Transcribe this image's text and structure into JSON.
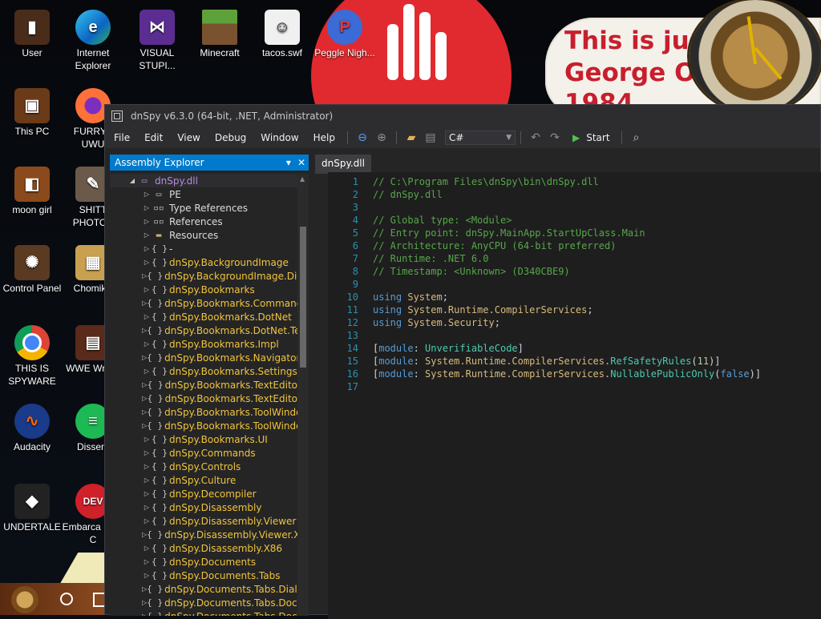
{
  "desktop": {
    "icons": [
      {
        "label": "User",
        "icon": "user-folder-icon"
      },
      {
        "label": "Internet Explorer",
        "icon": "edge-icon"
      },
      {
        "label": "VISUAL STUPI...",
        "icon": "visual-studio-icon"
      },
      {
        "label": "Minecraft",
        "icon": "minecraft-icon"
      },
      {
        "label": "tacos.swf",
        "icon": "swf-file-icon"
      },
      {
        "label": "Peggle Nigh...",
        "icon": "peggle-icon"
      },
      {
        "label": "This PC",
        "icon": "this-pc-icon"
      },
      {
        "label": "FURRYF UWU",
        "icon": "firefox-icon"
      },
      {
        "label": "moon girl",
        "icon": "moon-girl-icon"
      },
      {
        "label": "SHITT PHOTOS",
        "icon": "gimp-icon"
      },
      {
        "label": "Control Panel",
        "icon": "control-panel-icon"
      },
      {
        "label": "ChomikB",
        "icon": "chomik-icon"
      },
      {
        "label": "THIS IS SPYWARE",
        "icon": "chrome-icon"
      },
      {
        "label": "WWE Wrestl",
        "icon": "wwe-icon"
      },
      {
        "label": "Audacity",
        "icon": "audacity-icon"
      },
      {
        "label": "Dissent",
        "icon": "dissent-icon"
      },
      {
        "label": "UNDERTALE",
        "icon": "unity-icon"
      },
      {
        "label": "Embarca Dev-C",
        "icon": "devcpp-icon"
      }
    ],
    "wallpaper_text": [
      "This is just",
      "George Or",
      "1984"
    ]
  },
  "window": {
    "title": "dnSpy v6.3.0 (64-bit, .NET, Administrator)",
    "menu": [
      "File",
      "Edit",
      "View",
      "Debug",
      "Window",
      "Help"
    ],
    "language": "C#",
    "start_label": "Start"
  },
  "explorer": {
    "title": "Assembly Explorer",
    "root": "dnSpy.dll",
    "items": [
      {
        "label": "PE",
        "type": "pe"
      },
      {
        "label": "Type References",
        "type": "ref"
      },
      {
        "label": "References",
        "type": "ref"
      },
      {
        "label": "Resources",
        "type": "folder"
      },
      {
        "label": "-",
        "type": "ns"
      },
      {
        "label": "dnSpy.BackgroundImage",
        "type": "ns"
      },
      {
        "label": "dnSpy.BackgroundImage.Dialog",
        "type": "ns"
      },
      {
        "label": "dnSpy.Bookmarks",
        "type": "ns"
      },
      {
        "label": "dnSpy.Bookmarks.Commands",
        "type": "ns"
      },
      {
        "label": "dnSpy.Bookmarks.DotNet",
        "type": "ns"
      },
      {
        "label": "dnSpy.Bookmarks.DotNet.Te",
        "type": "ns"
      },
      {
        "label": "dnSpy.Bookmarks.Impl",
        "type": "ns"
      },
      {
        "label": "dnSpy.Bookmarks.Navigator",
        "type": "ns"
      },
      {
        "label": "dnSpy.Bookmarks.Settings",
        "type": "ns"
      },
      {
        "label": "dnSpy.Bookmarks.TextEdito",
        "type": "ns"
      },
      {
        "label": "dnSpy.Bookmarks.TextEdito",
        "type": "ns"
      },
      {
        "label": "dnSpy.Bookmarks.ToolWindo",
        "type": "ns"
      },
      {
        "label": "dnSpy.Bookmarks.ToolWindo",
        "type": "ns"
      },
      {
        "label": "dnSpy.Bookmarks.UI",
        "type": "ns"
      },
      {
        "label": "dnSpy.Commands",
        "type": "ns"
      },
      {
        "label": "dnSpy.Controls",
        "type": "ns"
      },
      {
        "label": "dnSpy.Culture",
        "type": "ns"
      },
      {
        "label": "dnSpy.Decompiler",
        "type": "ns"
      },
      {
        "label": "dnSpy.Disassembly",
        "type": "ns"
      },
      {
        "label": "dnSpy.Disassembly.Viewer",
        "type": "ns"
      },
      {
        "label": "dnSpy.Disassembly.Viewer.X",
        "type": "ns"
      },
      {
        "label": "dnSpy.Disassembly.X86",
        "type": "ns"
      },
      {
        "label": "dnSpy.Documents",
        "type": "ns"
      },
      {
        "label": "dnSpy.Documents.Tabs",
        "type": "ns"
      },
      {
        "label": "dnSpy.Documents.Tabs.Dialo",
        "type": "ns"
      },
      {
        "label": "dnSpy.Documents.Tabs.DocV",
        "type": "ns"
      },
      {
        "label": "dnSpy.Documents.Tabs.DocV",
        "type": "ns"
      }
    ]
  },
  "editor": {
    "tab": "dnSpy.dll",
    "lines": [
      {
        "n": "1",
        "tokens": [
          {
            "t": "// C:\\Program Files\\dnSpy\\bin\\dnSpy.dll",
            "c": "comment"
          }
        ]
      },
      {
        "n": "2",
        "tokens": [
          {
            "t": "// dnSpy.dll",
            "c": "comment"
          }
        ]
      },
      {
        "n": "3",
        "tokens": []
      },
      {
        "n": "4",
        "tokens": [
          {
            "t": "// Global type: <Module>",
            "c": "comment"
          }
        ]
      },
      {
        "n": "5",
        "tokens": [
          {
            "t": "// Entry point: dnSpy.MainApp.StartUpClass.Main",
            "c": "comment"
          }
        ]
      },
      {
        "n": "6",
        "tokens": [
          {
            "t": "// Architecture: AnyCPU (64-bit preferred)",
            "c": "comment"
          }
        ]
      },
      {
        "n": "7",
        "tokens": [
          {
            "t": "// Runtime: .NET 6.0",
            "c": "comment"
          }
        ]
      },
      {
        "n": "8",
        "tokens": [
          {
            "t": "// Timestamp: <Unknown> (D340CBE9)",
            "c": "comment"
          }
        ]
      },
      {
        "n": "9",
        "tokens": []
      },
      {
        "n": "10",
        "tokens": [
          {
            "t": "using",
            "c": "kw"
          },
          {
            "t": " ",
            "c": "plain"
          },
          {
            "t": "System",
            "c": "ns"
          },
          {
            "t": ";",
            "c": "plain"
          }
        ]
      },
      {
        "n": "11",
        "tokens": [
          {
            "t": "using",
            "c": "kw"
          },
          {
            "t": " ",
            "c": "plain"
          },
          {
            "t": "System.Runtime.CompilerServices",
            "c": "ns"
          },
          {
            "t": ";",
            "c": "plain"
          }
        ]
      },
      {
        "n": "12",
        "tokens": [
          {
            "t": "using",
            "c": "kw"
          },
          {
            "t": " ",
            "c": "plain"
          },
          {
            "t": "System.Security",
            "c": "ns"
          },
          {
            "t": ";",
            "c": "plain"
          }
        ]
      },
      {
        "n": "13",
        "tokens": []
      },
      {
        "n": "14",
        "tokens": [
          {
            "t": "[",
            "c": "plain"
          },
          {
            "t": "module",
            "c": "kw"
          },
          {
            "t": ": ",
            "c": "plain"
          },
          {
            "t": "UnverifiableCode",
            "c": "type"
          },
          {
            "t": "]",
            "c": "plain"
          }
        ]
      },
      {
        "n": "15",
        "tokens": [
          {
            "t": "[",
            "c": "plain"
          },
          {
            "t": "module",
            "c": "kw"
          },
          {
            "t": ": ",
            "c": "plain"
          },
          {
            "t": "System.Runtime.CompilerServices.",
            "c": "ns"
          },
          {
            "t": "RefSafetyRules",
            "c": "type"
          },
          {
            "t": "(",
            "c": "plain"
          },
          {
            "t": "11",
            "c": "num"
          },
          {
            "t": ")]",
            "c": "plain"
          }
        ]
      },
      {
        "n": "16",
        "tokens": [
          {
            "t": "[",
            "c": "plain"
          },
          {
            "t": "module",
            "c": "kw"
          },
          {
            "t": ": ",
            "c": "plain"
          },
          {
            "t": "System.Runtime.CompilerServices.",
            "c": "ns"
          },
          {
            "t": "NullablePublicOnly",
            "c": "type"
          },
          {
            "t": "(",
            "c": "plain"
          },
          {
            "t": "false",
            "c": "kw"
          },
          {
            "t": ")]",
            "c": "plain"
          }
        ]
      },
      {
        "n": "17",
        "tokens": []
      }
    ]
  }
}
